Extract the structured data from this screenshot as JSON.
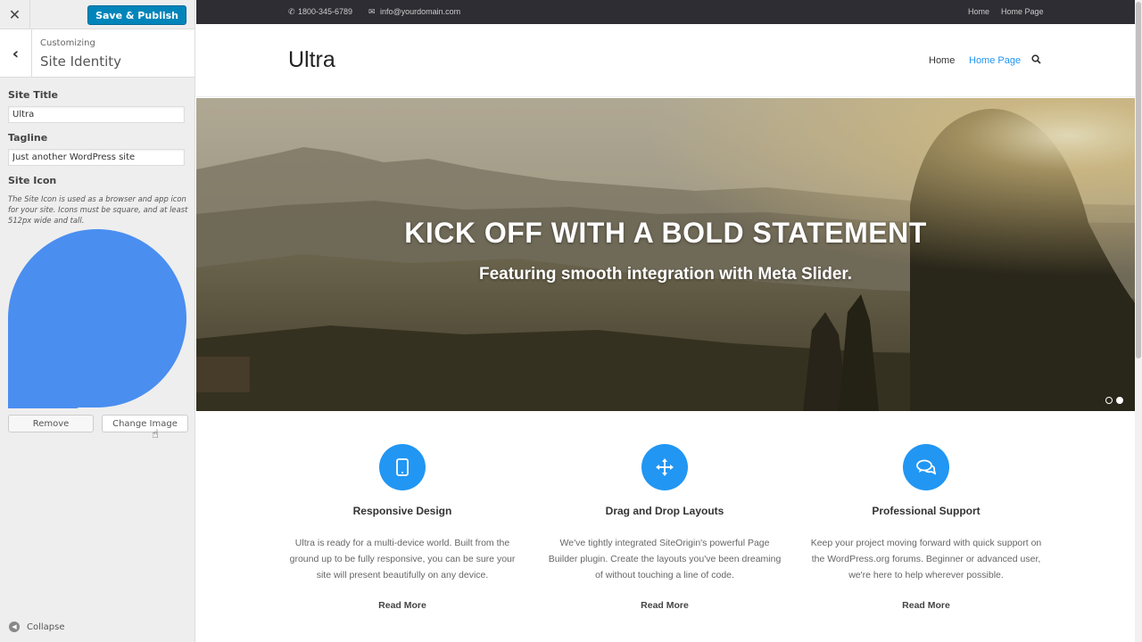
{
  "customizer": {
    "save_label": "Save & Publish",
    "breadcrumb": "Customizing",
    "section_title": "Site Identity",
    "site_title_label": "Site Title",
    "site_title_value": "Ultra",
    "tagline_label": "Tagline",
    "tagline_value": "Just another WordPress site",
    "site_icon_label": "Site Icon",
    "site_icon_description": "The Site Icon is used as a browser and app icon for your site. Icons must be square, and at least 512px wide and tall.",
    "remove_label": "Remove",
    "change_image_label": "Change Image",
    "collapse_label": "Collapse",
    "icon_color": "#4a8ef0",
    "accent_color": "#0085ba"
  },
  "site": {
    "topbar": {
      "phone": "1800-345-6789",
      "email": "info@yourdomain.com",
      "links": [
        "Home",
        "Home Page"
      ]
    },
    "logo": "Ultra",
    "nav": [
      "Home",
      "Home Page"
    ],
    "active_nav": "Home Page",
    "hero": {
      "title": "KICK OFF WITH A BOLD STATEMENT",
      "subtitle": "Featuring smooth integration with Meta Slider.",
      "slides": 2,
      "active_slide": 2
    },
    "features": [
      {
        "icon": "tablet-icon",
        "title": "Responsive Design",
        "text": "Ultra is ready for a multi-device world. Built from the ground up to be fully responsive, you can be sure your site will present beautifully on any device.",
        "more": "Read More"
      },
      {
        "icon": "move-icon",
        "title": "Drag and Drop Layouts",
        "text": "We've tightly integrated SiteOrigin's powerful Page Builder plugin. Create the layouts you've been dreaming of without touching a line of code.",
        "more": "Read More"
      },
      {
        "icon": "chat-icon",
        "title": "Professional Support",
        "text": "Keep your project moving forward with quick support on the WordPress.org forums. Beginner or advanced user, we're here to help wherever possible.",
        "more": "Read More"
      }
    ],
    "link_color": "#2196f3"
  }
}
